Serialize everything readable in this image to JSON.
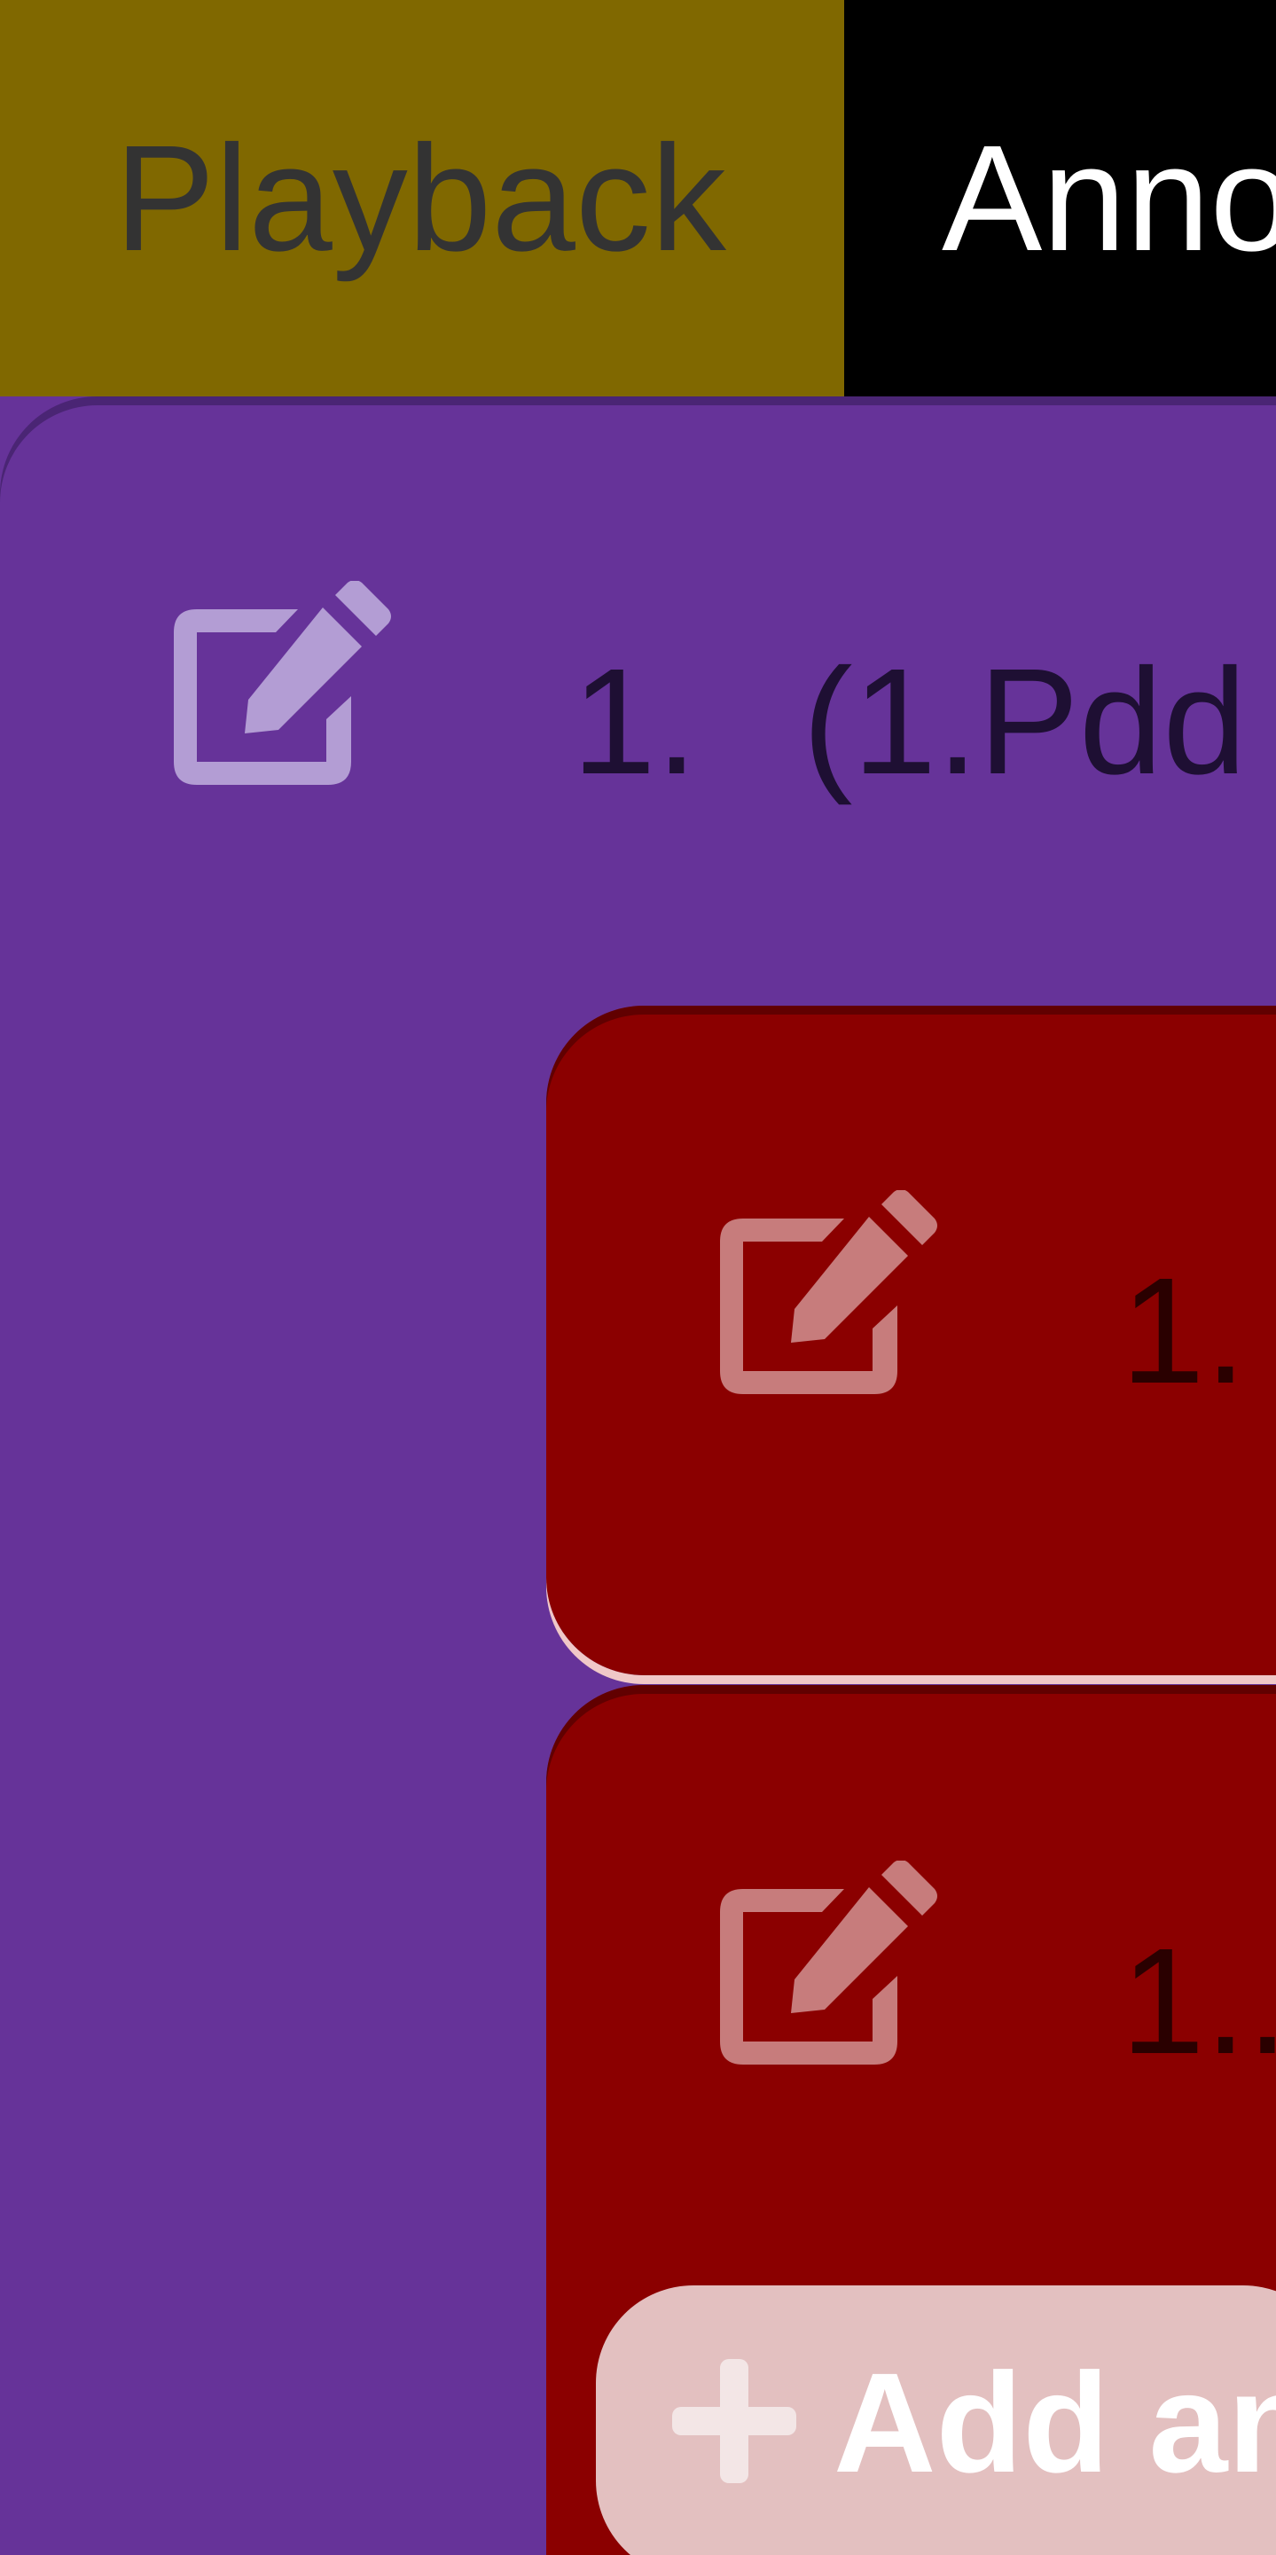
{
  "tabs": {
    "playback_label": "Playback",
    "annotations_label": "Anno"
  },
  "main_annotation": {
    "number": "1.",
    "text": "(1.Pdd"
  },
  "sub_annotations": [
    {
      "number": "1."
    },
    {
      "number": "1.."
    }
  ],
  "add_button": {
    "label": "Add an"
  },
  "colors": {
    "playback_tab": "#806800",
    "annotations_tab": "#000000",
    "panel": "#663399",
    "card": "#8b0000",
    "add_button": "#e3c0c0"
  },
  "icons": {
    "edit": "edit-icon",
    "plus": "plus-icon"
  }
}
